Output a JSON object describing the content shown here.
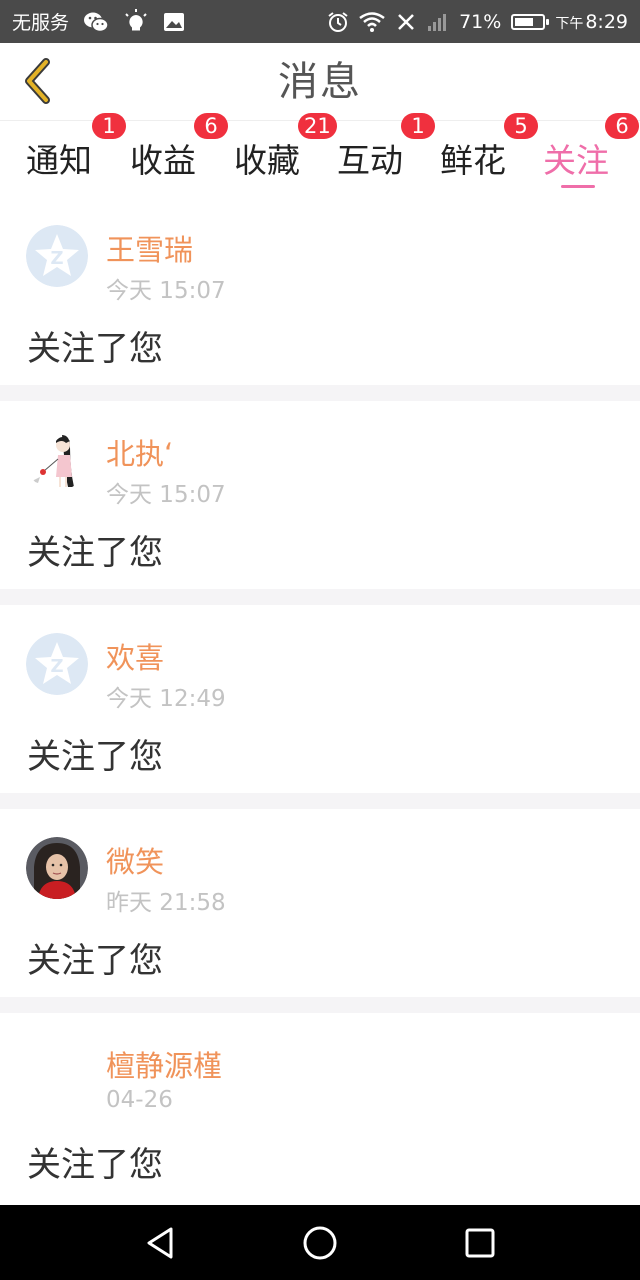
{
  "status_bar": {
    "carrier": "无服务",
    "battery": "71%",
    "time_prefix": "下午",
    "time": "8:29",
    "battery_level": 0.71,
    "icons": [
      "wechat-icon",
      "bulb-icon",
      "image-icon",
      "alarm-icon",
      "wifi-icon",
      "no-signal-icon",
      "signal-icon",
      "battery-icon"
    ]
  },
  "header": {
    "title": "消息",
    "back_icon": "chevron-left-icon"
  },
  "tabs": [
    {
      "label": "通知",
      "badge": "1"
    },
    {
      "label": "收益",
      "badge": "6"
    },
    {
      "label": "收藏",
      "badge": "21"
    },
    {
      "label": "互动",
      "badge": "1"
    },
    {
      "label": "鲜花",
      "badge": "5"
    },
    {
      "label": "关注",
      "badge": "6",
      "active": true
    }
  ],
  "messages": [
    {
      "name": "王雪瑞",
      "time": "今天 15:07",
      "content": "关注了您",
      "avatar": "default-avatar-icon"
    },
    {
      "name": "北执‘",
      "time": "今天 15:07",
      "content": "关注了您",
      "avatar": "illustration-avatar"
    },
    {
      "name": "欢喜",
      "time": "今天 12:49",
      "content": "关注了您",
      "avatar": "default-avatar-icon"
    },
    {
      "name": "微笑",
      "time": "昨天 21:58",
      "content": "关注了您",
      "avatar": "photo-avatar"
    },
    {
      "name": "檀静源槿",
      "time": "04-26",
      "content": "关注了您",
      "avatar": "blank-avatar"
    }
  ],
  "colors": {
    "accent": "#ef6ea9",
    "name": "#f0935a",
    "badge": "#f0303e",
    "back_chevron": "#e3b227"
  },
  "navbar": {
    "icons": [
      "nav-back-icon",
      "nav-home-icon",
      "nav-recent-icon"
    ]
  }
}
